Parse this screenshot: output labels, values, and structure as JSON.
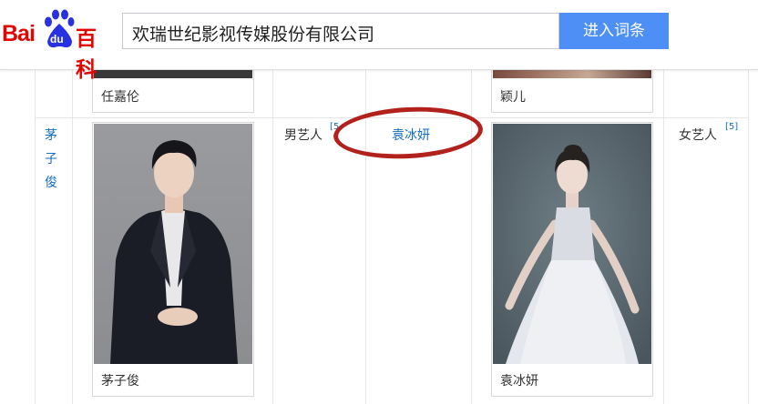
{
  "header": {
    "logo_text": "Bai",
    "logo_du": "du",
    "logo_baike": "百科",
    "search_value": "欢瑞世纪影视传媒股份有限公司",
    "enter_button": "进入词条",
    "colors": {
      "logo_red": "#e10601",
      "button_blue": "#4e8ff5",
      "link_blue": "#136ec2",
      "annotation_red": "#b3211c"
    }
  },
  "table": {
    "prev_row": {
      "left_caption": "任嘉伦",
      "right_caption": "颖儿"
    },
    "row": {
      "artist_link": "茅子俊",
      "artist_photo_caption": "茅子俊",
      "artist_type": "男艺人",
      "artist_ref": "[5",
      "partner_link": "袁冰妍",
      "partner_photo_caption": "袁冰妍",
      "partner_type": "女艺人",
      "partner_ref": "[5]"
    }
  }
}
